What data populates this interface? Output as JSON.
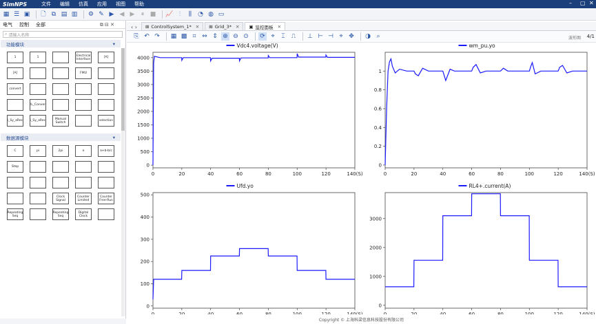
{
  "app": {
    "logo": "SimNPS",
    "menus": [
      "文件",
      "编辑",
      "仿真",
      "应用",
      "视图",
      "帮助"
    ]
  },
  "window": {
    "minimize": "–",
    "maximize": "▢",
    "close": "✕"
  },
  "left_panel": {
    "tabs": [
      "电气",
      "控制",
      "全部"
    ],
    "search_placeholder": "请输入名称",
    "section1": {
      "title": "功能模块",
      "blocks": [
        "1",
        "1",
        "",
        "Electrical Interface",
        "[A]",
        "[A]",
        "",
        "",
        "FMU",
        "",
        "convert",
        "",
        "",
        "",
        "",
        "",
        "RL_Convert",
        "",
        "",
        "",
        "Si_Sy_aRecd",
        "Si_Sy_aRecd",
        "Manual Switch",
        "",
        "selection"
      ]
    },
    "section2": {
      "title": "数据源模块",
      "blocks": [
        "C",
        "pi",
        "2pi",
        "e",
        "a+b-b/c",
        "Step",
        "",
        "",
        "",
        "",
        "",
        "",
        "",
        "",
        "",
        "",
        "",
        "Clock Signal",
        "Counter Limited",
        "Counter Free-Run",
        "Repeating Seq",
        "",
        "Repeating Seq",
        "Digital Clock",
        ""
      ]
    }
  },
  "tabs": [
    {
      "label": "ControlSystem_1*"
    },
    {
      "label": "Grid_3*"
    },
    {
      "label": "监控面板"
    }
  ],
  "scope": {
    "info": "波形图",
    "page": "4/1"
  },
  "footer": "Copyright © 上海科梁信息科技股份有限公司",
  "chart_data": [
    {
      "type": "line",
      "title": "Vdc4.voltage(V)",
      "series": [
        {
          "name": "Vdc4.voltage(V)",
          "color": "#1a1aff"
        }
      ],
      "xlim": [
        0,
        140
      ],
      "ylim": [
        -100,
        4200
      ],
      "xticks": [
        0,
        20,
        40,
        60,
        80,
        100,
        120,
        140
      ],
      "yticks": [
        0,
        500,
        1000,
        1500,
        2000,
        2500,
        3000,
        3500,
        4000
      ],
      "xlabel": "140(S)",
      "points": [
        [
          0,
          0
        ],
        [
          0.5,
          3800
        ],
        [
          1,
          4050
        ],
        [
          5,
          4000
        ],
        [
          19.9,
          4000
        ],
        [
          20,
          3900
        ],
        [
          21,
          4000
        ],
        [
          39.9,
          4000
        ],
        [
          40,
          3880
        ],
        [
          41,
          3980
        ],
        [
          59.9,
          3980
        ],
        [
          60,
          3880
        ],
        [
          61,
          3990
        ],
        [
          79.9,
          3990
        ],
        [
          80,
          4080
        ],
        [
          81,
          4000
        ],
        [
          99.9,
          4000
        ],
        [
          100,
          4150
        ],
        [
          101,
          4020
        ],
        [
          119.9,
          4020
        ],
        [
          120,
          4100
        ],
        [
          121,
          4010
        ],
        [
          140,
          4010
        ]
      ]
    },
    {
      "type": "line",
      "title": "wm_pu.yo",
      "series": [
        {
          "name": "wm_pu.yo",
          "color": "#1a1aff"
        }
      ],
      "xlim": [
        0,
        140
      ],
      "ylim": [
        -0.03,
        1.2
      ],
      "xticks": [
        0,
        20,
        40,
        60,
        80,
        100,
        120,
        140
      ],
      "yticks": [
        0,
        0.2,
        0.4,
        0.6,
        0.8,
        1
      ],
      "xlabel": "140(S)",
      "points": [
        [
          0,
          0
        ],
        [
          1,
          0.6
        ],
        [
          2,
          1.0
        ],
        [
          3,
          1.1
        ],
        [
          4,
          1.13
        ],
        [
          5,
          1.05
        ],
        [
          7,
          0.98
        ],
        [
          10,
          1.02
        ],
        [
          15,
          1.0
        ],
        [
          20,
          1.0
        ],
        [
          21,
          0.97
        ],
        [
          23,
          0.95
        ],
        [
          26,
          1.03
        ],
        [
          30,
          1.0
        ],
        [
          40,
          1.0
        ],
        [
          41,
          0.95
        ],
        [
          42,
          0.9
        ],
        [
          45,
          1.02
        ],
        [
          48,
          1.0
        ],
        [
          60,
          1.0
        ],
        [
          61,
          1.04
        ],
        [
          63,
          1.07
        ],
        [
          66,
          0.98
        ],
        [
          70,
          1.0
        ],
        [
          80,
          1.0
        ],
        [
          82,
          1.03
        ],
        [
          85,
          1.0
        ],
        [
          100,
          1.0
        ],
        [
          101,
          1.05
        ],
        [
          102,
          1.09
        ],
        [
          104,
          0.97
        ],
        [
          108,
          1.0
        ],
        [
          120,
          1.0
        ],
        [
          121,
          1.04
        ],
        [
          123,
          1.06
        ],
        [
          126,
          0.98
        ],
        [
          130,
          1.0
        ],
        [
          140,
          1.0
        ]
      ]
    },
    {
      "type": "line",
      "title": "Ufd.yo",
      "series": [
        {
          "name": "Ufd.yo",
          "color": "#1a1aff"
        }
      ],
      "xlim": [
        0,
        140
      ],
      "ylim": [
        -10,
        510
      ],
      "xticks": [
        0,
        20,
        40,
        60,
        80,
        100,
        120,
        140
      ],
      "yticks": [
        0,
        100,
        200,
        300,
        400,
        500
      ],
      "xlabel": "140(S)",
      "points": [
        [
          0,
          30
        ],
        [
          0.5,
          120
        ],
        [
          19.9,
          120
        ],
        [
          20,
          160
        ],
        [
          39.9,
          160
        ],
        [
          40,
          225
        ],
        [
          59.9,
          225
        ],
        [
          60,
          258
        ],
        [
          79.9,
          258
        ],
        [
          80,
          225
        ],
        [
          99.9,
          225
        ],
        [
          100,
          160
        ],
        [
          119.9,
          160
        ],
        [
          120,
          120
        ],
        [
          140,
          120
        ]
      ]
    },
    {
      "type": "line",
      "title": "RL4+.current(A)",
      "series": [
        {
          "name": "RL4+.current(A)",
          "color": "#1a1aff"
        }
      ],
      "xlim": [
        0,
        140
      ],
      "ylim": [
        -100,
        3900
      ],
      "xticks": [
        0,
        20,
        40,
        60,
        80,
        100,
        120,
        140
      ],
      "yticks": [
        0,
        1000,
        2000,
        3000
      ],
      "xlabel": "140(S)",
      "points": [
        [
          0,
          640
        ],
        [
          19.9,
          640
        ],
        [
          20,
          1560
        ],
        [
          39.9,
          1560
        ],
        [
          40,
          3100
        ],
        [
          59.9,
          3100
        ],
        [
          60,
          3860
        ],
        [
          79.9,
          3860
        ],
        [
          80,
          3100
        ],
        [
          99.9,
          3100
        ],
        [
          100,
          1560
        ],
        [
          119.9,
          1560
        ],
        [
          120,
          640
        ],
        [
          140,
          640
        ]
      ]
    }
  ]
}
